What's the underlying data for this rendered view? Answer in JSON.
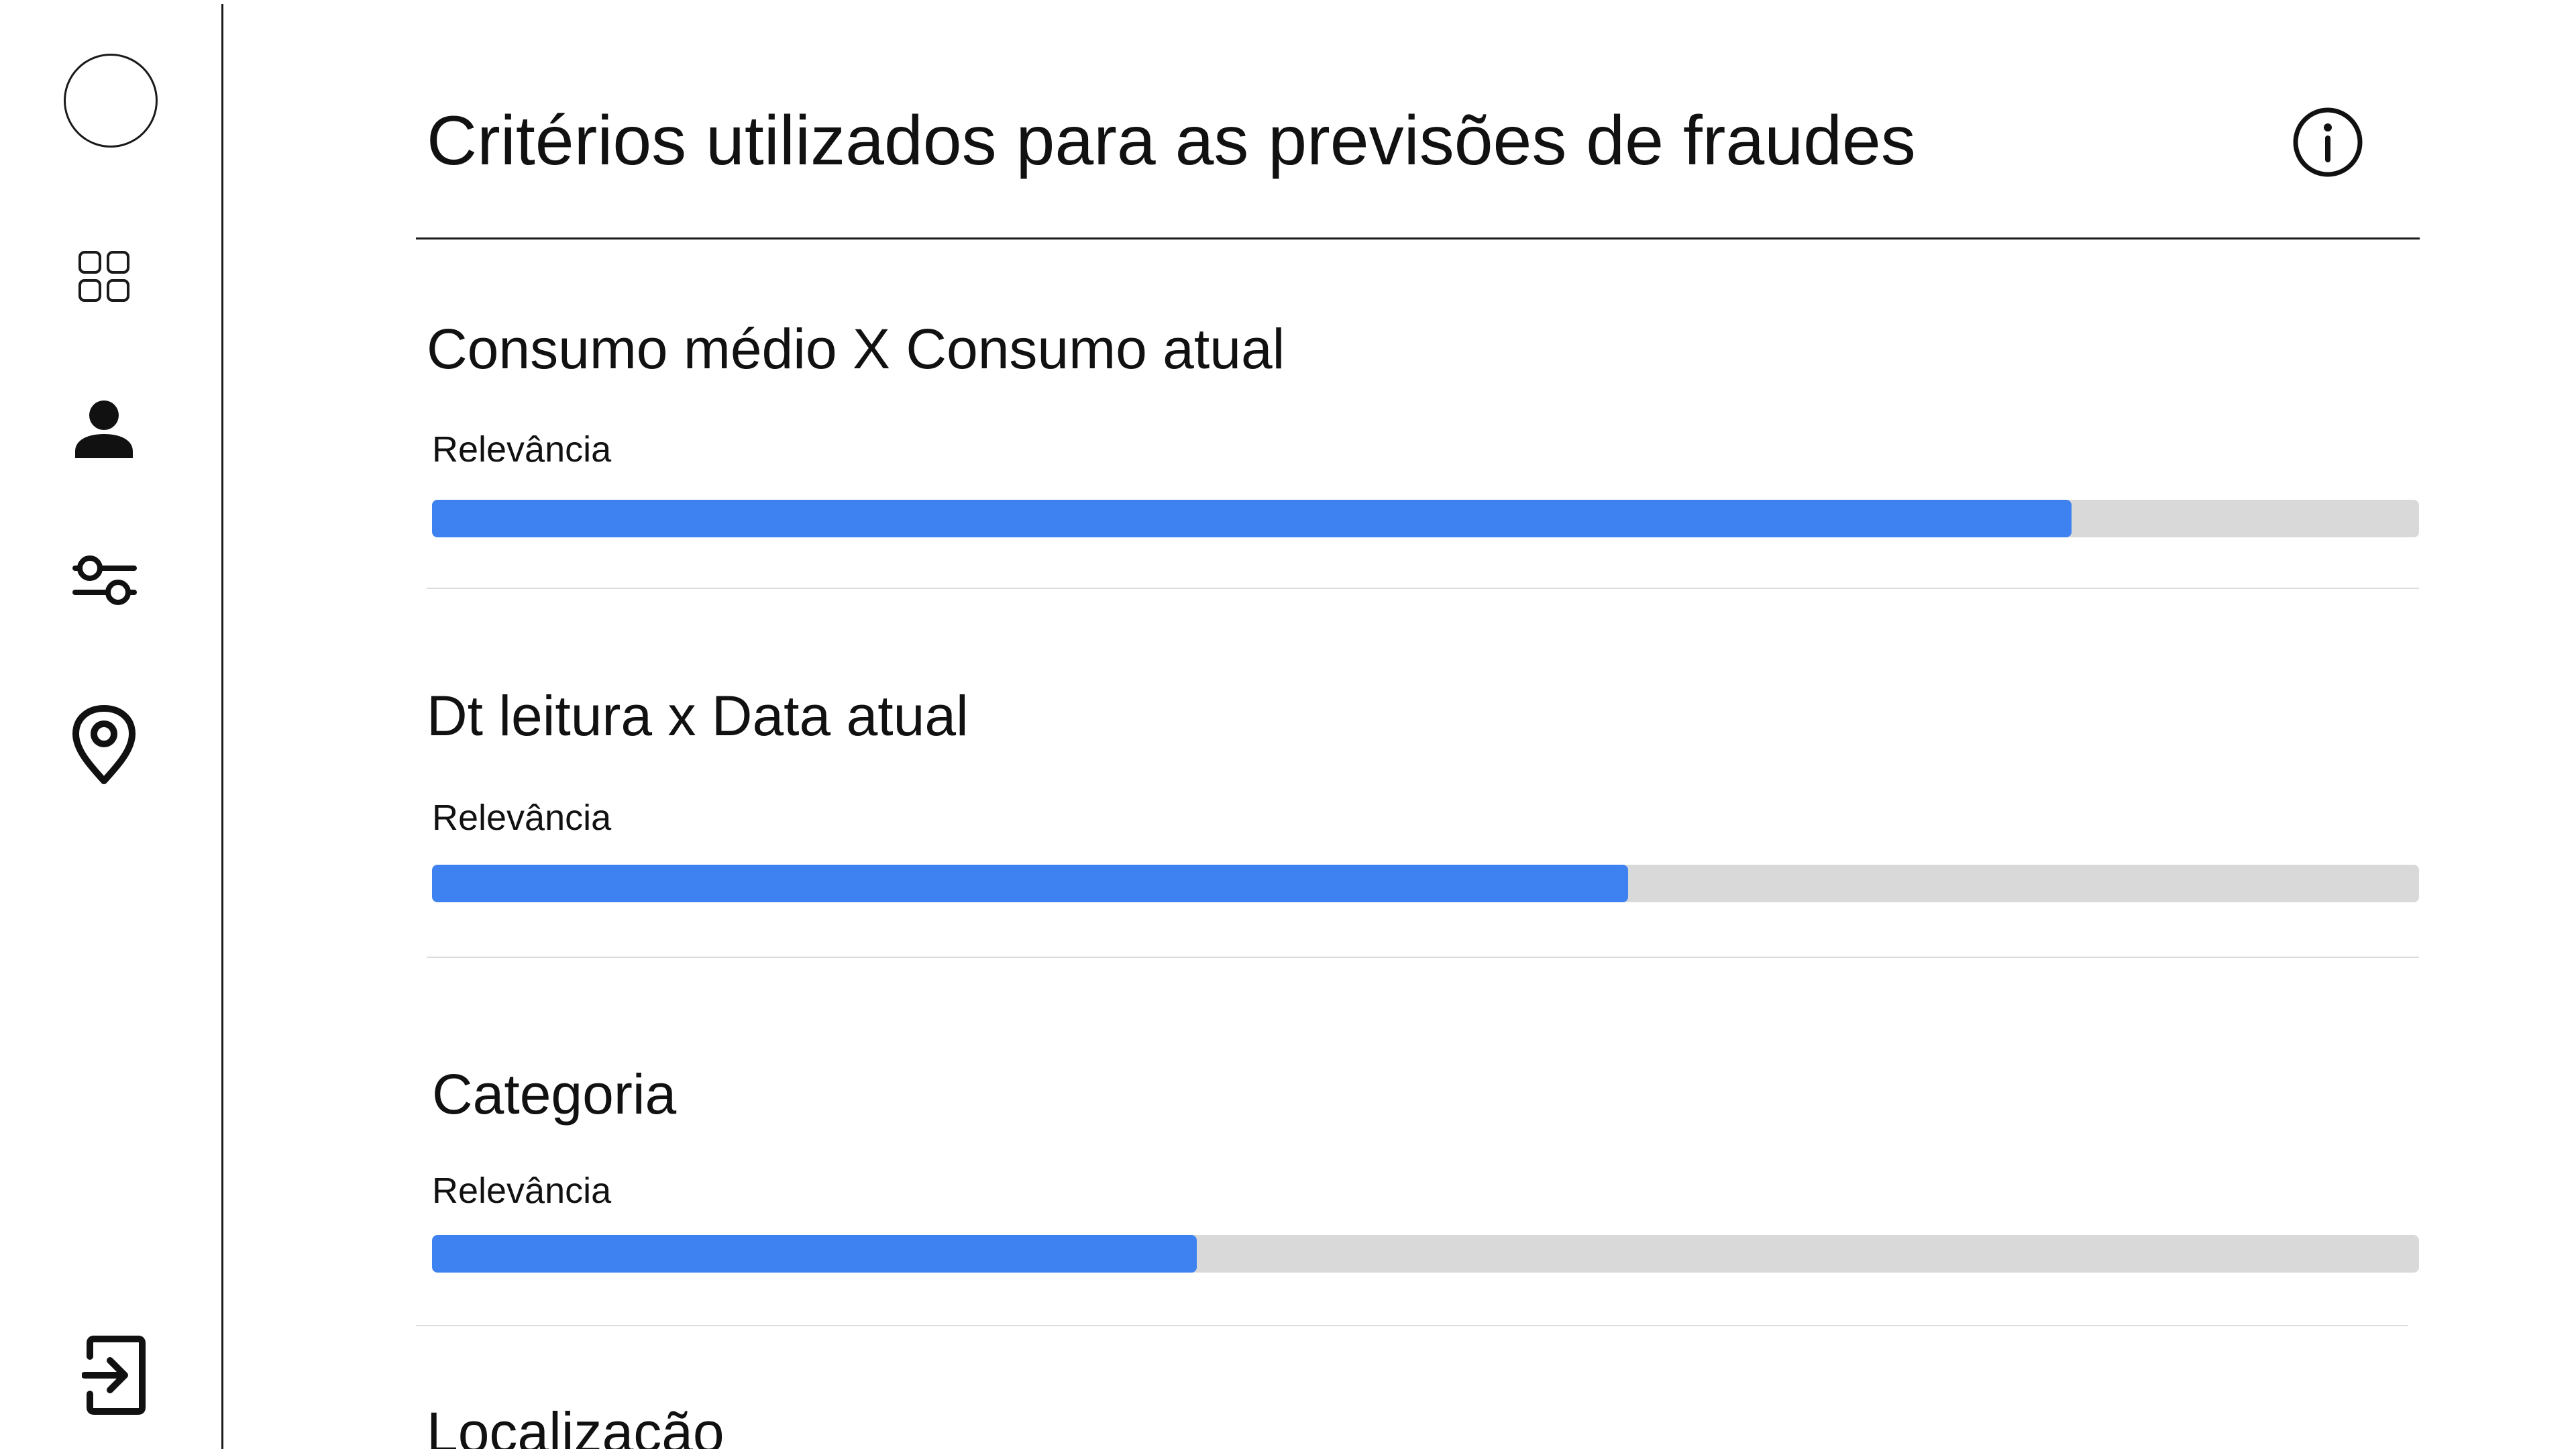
{
  "sidebar": {
    "items": [
      {
        "name": "dashboard",
        "icon": "grid-icon"
      },
      {
        "name": "users",
        "icon": "user-icon"
      },
      {
        "name": "filters",
        "icon": "sliders-icon"
      },
      {
        "name": "locations",
        "icon": "map-pin-icon"
      }
    ],
    "logout_icon": "logout-icon"
  },
  "header": {
    "title": "Critérios utilizados para as previsões de fraudes",
    "info_icon": "info-icon"
  },
  "criteria": [
    {
      "title": "Consumo médio X Consumo atual",
      "relevance_label": "Relevância",
      "relevance": 0.825
    },
    {
      "title": "Dt leitura x Data atual",
      "relevance_label": "Relevância",
      "relevance": 0.602
    },
    {
      "title": "Categoria",
      "relevance_label": "Relevância",
      "relevance": 0.385
    },
    {
      "title": "Localização"
    }
  ],
  "colors": {
    "accent": "#3d82f0",
    "track": "#d9d9d9",
    "text": "#111111"
  }
}
